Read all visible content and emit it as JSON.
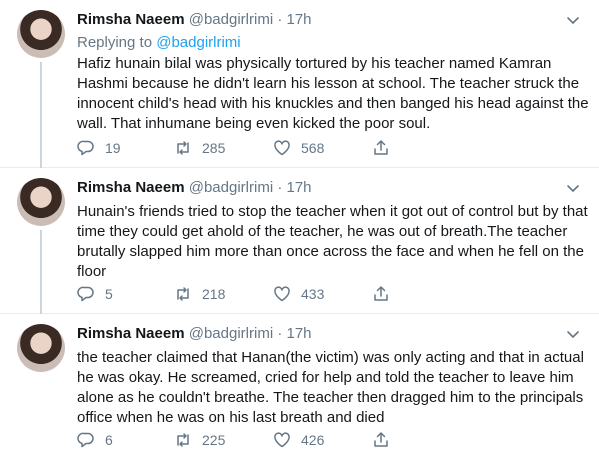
{
  "tweets": [
    {
      "author_name": "Rimsha Naeem",
      "author_handle": "@badgirlrimi",
      "separator": "·",
      "time": "17h",
      "reply_prefix": "Replying to",
      "reply_handle": "@badgirlrimi",
      "text": "Hafiz hunain bilal was physically tortured by his teacher named Kamran Hashmi because he didn't learn his lesson at school. The teacher struck the innocent child's head with his knuckles and then banged his head against the wall. That inhumane being even kicked the poor soul.",
      "replies": "19",
      "retweets": "285",
      "likes": "568"
    },
    {
      "author_name": "Rimsha Naeem",
      "author_handle": "@badgirlrimi",
      "separator": "·",
      "time": "17h",
      "text": "Hunain's friends tried to stop the teacher when it got out of control but by that time they could get ahold of the teacher, he was out of breath.The teacher brutally slapped him more than once across the face and  when he fell on the floor",
      "replies": "5",
      "retweets": "218",
      "likes": "433"
    },
    {
      "author_name": "Rimsha Naeem",
      "author_handle": "@badgirlrimi",
      "separator": "·",
      "time": "17h",
      "text": "the teacher claimed that Hanan(the victim) was only acting and that in actual he was okay. He screamed, cried for help and told the teacher to leave him alone as he couldn't breathe. The teacher then dragged him to the principals office when he was on his last breath and died",
      "replies": "6",
      "retweets": "225",
      "likes": "426"
    }
  ],
  "colors": {
    "text": "#14171a",
    "secondary": "#657786",
    "link": "#1da1f2",
    "divider": "#e6ecf0"
  },
  "icons": [
    "chevron-down-icon",
    "reply-icon",
    "retweet-icon",
    "like-icon",
    "share-icon"
  ]
}
